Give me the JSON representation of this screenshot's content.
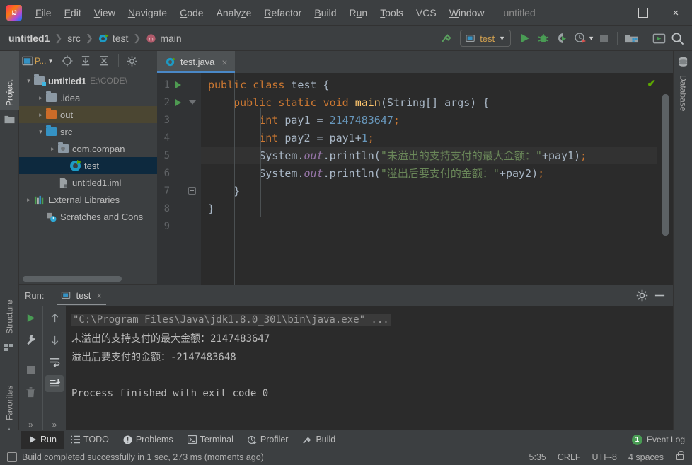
{
  "window": {
    "title": "untitled",
    "minimize_label": "minimize",
    "maximize_label": "maximize",
    "close_label": "×"
  },
  "menu": {
    "items": [
      {
        "label": "File",
        "mnemonic": "F"
      },
      {
        "label": "Edit",
        "mnemonic": "E"
      },
      {
        "label": "View",
        "mnemonic": "V"
      },
      {
        "label": "Navigate",
        "mnemonic": "N"
      },
      {
        "label": "Code",
        "mnemonic": "C"
      },
      {
        "label": "Analyze",
        "mnemonic": "z"
      },
      {
        "label": "Refactor",
        "mnemonic": "R"
      },
      {
        "label": "Build",
        "mnemonic": "B"
      },
      {
        "label": "Run",
        "mnemonic": "u"
      },
      {
        "label": "Tools",
        "mnemonic": "T"
      },
      {
        "label": "VCS",
        "mnemonic": ""
      },
      {
        "label": "Window",
        "mnemonic": "W"
      }
    ]
  },
  "breadcrumb": {
    "project": "untitled1",
    "src": "src",
    "class": "test",
    "method": "main",
    "sep": "❯"
  },
  "toolbar": {
    "build_hammer": "build-icon",
    "run_config": "test",
    "run_label": "run-icon",
    "debug_label": "debug-icon",
    "coverage_label": "run-with-coverage-icon",
    "profile_label": "profile-icon",
    "stop_label": "stop-icon",
    "project_structure": "project-structure-icon",
    "updates": "updates-icon",
    "search": "search-icon"
  },
  "left_strip": {
    "project": "Project",
    "structure": "Structure",
    "favorites": "Favorites"
  },
  "right_strip": {
    "database": "Database"
  },
  "project_panel": {
    "title": "P...",
    "tree": [
      {
        "indent": 0,
        "arrow": "⌄",
        "icon": "module",
        "name": "untitled1",
        "bold": true,
        "path": "E:\\CODE\\",
        "state": "normal"
      },
      {
        "indent": 1,
        "arrow": "›",
        "icon": "folder-gray",
        "name": ".idea",
        "bold": false,
        "path": "",
        "state": "normal"
      },
      {
        "indent": 1,
        "arrow": "›",
        "icon": "folder-orange",
        "name": "out",
        "bold": false,
        "path": "",
        "state": "highlight"
      },
      {
        "indent": 1,
        "arrow": "⌄",
        "icon": "folder-blue",
        "name": "src",
        "bold": false,
        "path": "",
        "state": "normal"
      },
      {
        "indent": 2,
        "arrow": "›",
        "icon": "package",
        "name": "com.compan",
        "bold": false,
        "path": "",
        "state": "normal"
      },
      {
        "indent": 3,
        "arrow": "",
        "icon": "class-run",
        "name": "test",
        "bold": false,
        "path": "",
        "state": "selected"
      },
      {
        "indent": 2,
        "arrow": "",
        "icon": "iml",
        "name": "untitled1.iml",
        "bold": false,
        "path": "",
        "state": "normal"
      },
      {
        "indent": 0,
        "arrow": "›",
        "icon": "libraries",
        "name": "External Libraries",
        "bold": false,
        "path": "",
        "state": "normal"
      },
      {
        "indent": 1,
        "arrow": "",
        "icon": "scratches",
        "name": "Scratches and Cons",
        "bold": false,
        "path": "",
        "state": "normal"
      }
    ]
  },
  "editor": {
    "tab": {
      "label": "test.java",
      "close": "×"
    },
    "inspection_ok": "✔",
    "lines": [
      {
        "n": "1",
        "runnable": true,
        "fold": "none",
        "current": false,
        "tokens": [
          {
            "t": "public",
            "c": "kw"
          },
          {
            "t": " ",
            "c": "punct"
          },
          {
            "t": "class",
            "c": "kw"
          },
          {
            "t": " ",
            "c": "punct"
          },
          {
            "t": "test",
            "c": "ident"
          },
          {
            "t": " ",
            "c": "punct"
          },
          {
            "t": "{",
            "c": "punct"
          }
        ]
      },
      {
        "n": "2",
        "runnable": true,
        "fold": "tri",
        "current": false,
        "tokens": [
          {
            "t": "    ",
            "c": "punct"
          },
          {
            "t": "public",
            "c": "kw"
          },
          {
            "t": " ",
            "c": "punct"
          },
          {
            "t": "static",
            "c": "kw"
          },
          {
            "t": " ",
            "c": "punct"
          },
          {
            "t": "void",
            "c": "kw"
          },
          {
            "t": " ",
            "c": "punct"
          },
          {
            "t": "main",
            "c": "mth"
          },
          {
            "t": "(String[] args) {",
            "c": "punct"
          }
        ]
      },
      {
        "n": "3",
        "runnable": false,
        "fold": "none",
        "current": false,
        "tokens": [
          {
            "t": "        ",
            "c": "punct"
          },
          {
            "t": "int",
            "c": "kw"
          },
          {
            "t": " pay1 ",
            "c": "ident"
          },
          {
            "t": "= ",
            "c": "punct"
          },
          {
            "t": "2147483647",
            "c": "num"
          },
          {
            "t": ";",
            "c": "semi"
          }
        ]
      },
      {
        "n": "4",
        "runnable": false,
        "fold": "none",
        "current": false,
        "tokens": [
          {
            "t": "        ",
            "c": "punct"
          },
          {
            "t": "int",
            "c": "kw"
          },
          {
            "t": " pay2 ",
            "c": "ident"
          },
          {
            "t": "= pay1+",
            "c": "punct"
          },
          {
            "t": "1",
            "c": "num"
          },
          {
            "t": ";",
            "c": "semi"
          }
        ]
      },
      {
        "n": "5",
        "runnable": false,
        "fold": "none",
        "current": true,
        "tokens": [
          {
            "t": "        ",
            "c": "punct"
          },
          {
            "t": "System",
            "c": "ident"
          },
          {
            "t": ".",
            "c": "punct"
          },
          {
            "t": "out",
            "c": "fld"
          },
          {
            "t": ".println(",
            "c": "punct"
          },
          {
            "t": "\"未溢出的支持支付的最大金额：\"",
            "c": "str"
          },
          {
            "t": "+pay1)",
            "c": "punct"
          },
          {
            "t": ";",
            "c": "semi"
          }
        ]
      },
      {
        "n": "6",
        "runnable": false,
        "fold": "none",
        "current": false,
        "tokens": [
          {
            "t": "        ",
            "c": "punct"
          },
          {
            "t": "System",
            "c": "ident"
          },
          {
            "t": ".",
            "c": "punct"
          },
          {
            "t": "out",
            "c": "fld"
          },
          {
            "t": ".println(",
            "c": "punct"
          },
          {
            "t": "\"溢出后要支付的金额：\"",
            "c": "str"
          },
          {
            "t": "+pay2)",
            "c": "punct"
          },
          {
            "t": ";",
            "c": "semi"
          }
        ]
      },
      {
        "n": "7",
        "runnable": false,
        "fold": "end",
        "current": false,
        "tokens": [
          {
            "t": "    }",
            "c": "punct"
          }
        ]
      },
      {
        "n": "8",
        "runnable": false,
        "fold": "none",
        "current": false,
        "tokens": [
          {
            "t": "}",
            "c": "punct"
          }
        ]
      },
      {
        "n": "9",
        "runnable": false,
        "fold": "none",
        "current": false,
        "tokens": []
      }
    ]
  },
  "run_panel": {
    "title": "Run:",
    "tab": "test",
    "tab_close": "×",
    "settings_icon": "gear-icon",
    "hide_icon": "hide-icon",
    "tools": [
      "rerun-icon",
      "wrench-icon",
      "stop-icon",
      "trash-icon"
    ],
    "tools2": [
      "up-icon",
      "down-icon",
      "soft-wrap-icon",
      "scroll-to-end-icon"
    ],
    "expand": "»",
    "console": [
      {
        "text": "\"C:\\Program Files\\Java\\jdk1.8.0_301\\bin\\java.exe\" ...",
        "style": "cmd"
      },
      {
        "text": "未溢出的支持支付的最大金额：2147483647",
        "style": "out"
      },
      {
        "text": "溢出后要支付的金额：-2147483648",
        "style": "out"
      },
      {
        "text": "",
        "style": "blank"
      },
      {
        "text": "Process finished with exit code 0",
        "style": "out"
      }
    ]
  },
  "bottom_tabs": {
    "items": [
      {
        "label": "Run",
        "icon": "play-icon",
        "active": true
      },
      {
        "label": "TODO",
        "icon": "list-icon",
        "active": false
      },
      {
        "label": "Problems",
        "icon": "warning-icon",
        "active": false
      },
      {
        "label": "Terminal",
        "icon": "terminal-icon",
        "active": false
      },
      {
        "label": "Profiler",
        "icon": "profiler-icon",
        "active": false
      },
      {
        "label": "Build",
        "icon": "hammer-icon",
        "active": false
      }
    ],
    "event_log": {
      "label": "Event Log",
      "count": "1"
    }
  },
  "statusbar": {
    "message": "Build completed successfully in 1 sec, 273 ms (moments ago)",
    "caret": "5:35",
    "line_separator": "CRLF",
    "encoding": "UTF-8",
    "indent": "4 spaces",
    "lock": "unlocked-icon"
  },
  "colors": {
    "chrome": "#3c3f41",
    "editor_bg": "#2b2b2b",
    "gutter_bg": "#313335",
    "accent_blue": "#4a88c7",
    "selection": "#0d293e",
    "green": "#499c54",
    "keyword_orange": "#cc7832",
    "string_green": "#6a8759",
    "number_blue": "#6897bb",
    "field_purple": "#9876aa",
    "method_yellow": "#ffc66d"
  }
}
